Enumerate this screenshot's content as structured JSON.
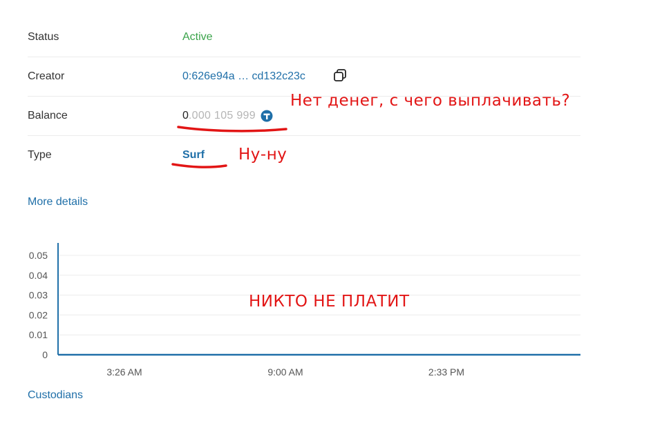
{
  "details": {
    "status": {
      "label": "Status",
      "value": "Active"
    },
    "creator": {
      "label": "Creator",
      "value": "0:626e94a … cd132c23c",
      "copy_icon": "copy-icon"
    },
    "balance": {
      "label": "Balance",
      "int": "0",
      "frac": ".000 105 999",
      "icon": "ton-coin-icon"
    },
    "type": {
      "label": "Type",
      "value": "Surf"
    }
  },
  "links": {
    "more_details": "More details",
    "custodians": "Custodians"
  },
  "annotations": {
    "no_money": "Нет денег, с чего выплачивать?",
    "nu_nu": "Ну-ну",
    "nobody_pays": "НИКТО НЕ ПЛАТИТ"
  },
  "colors": {
    "accent": "#1f6fa8",
    "active": "#3aa34a",
    "annotation": "#e21515",
    "chart_line": "#1f6fa8"
  },
  "chart_data": {
    "type": "line",
    "x": [
      "3:26 AM",
      "9:00 AM",
      "2:33 PM"
    ],
    "series": [
      {
        "values": [
          0,
          0,
          0
        ]
      }
    ],
    "ylim": [
      0,
      0.05
    ],
    "yticks": [
      "0",
      "0.01",
      "0.02",
      "0.03",
      "0.04",
      "0.05"
    ],
    "xticks": [
      "3:26 AM",
      "9:00 AM",
      "2:33 PM"
    ],
    "grid": true
  }
}
